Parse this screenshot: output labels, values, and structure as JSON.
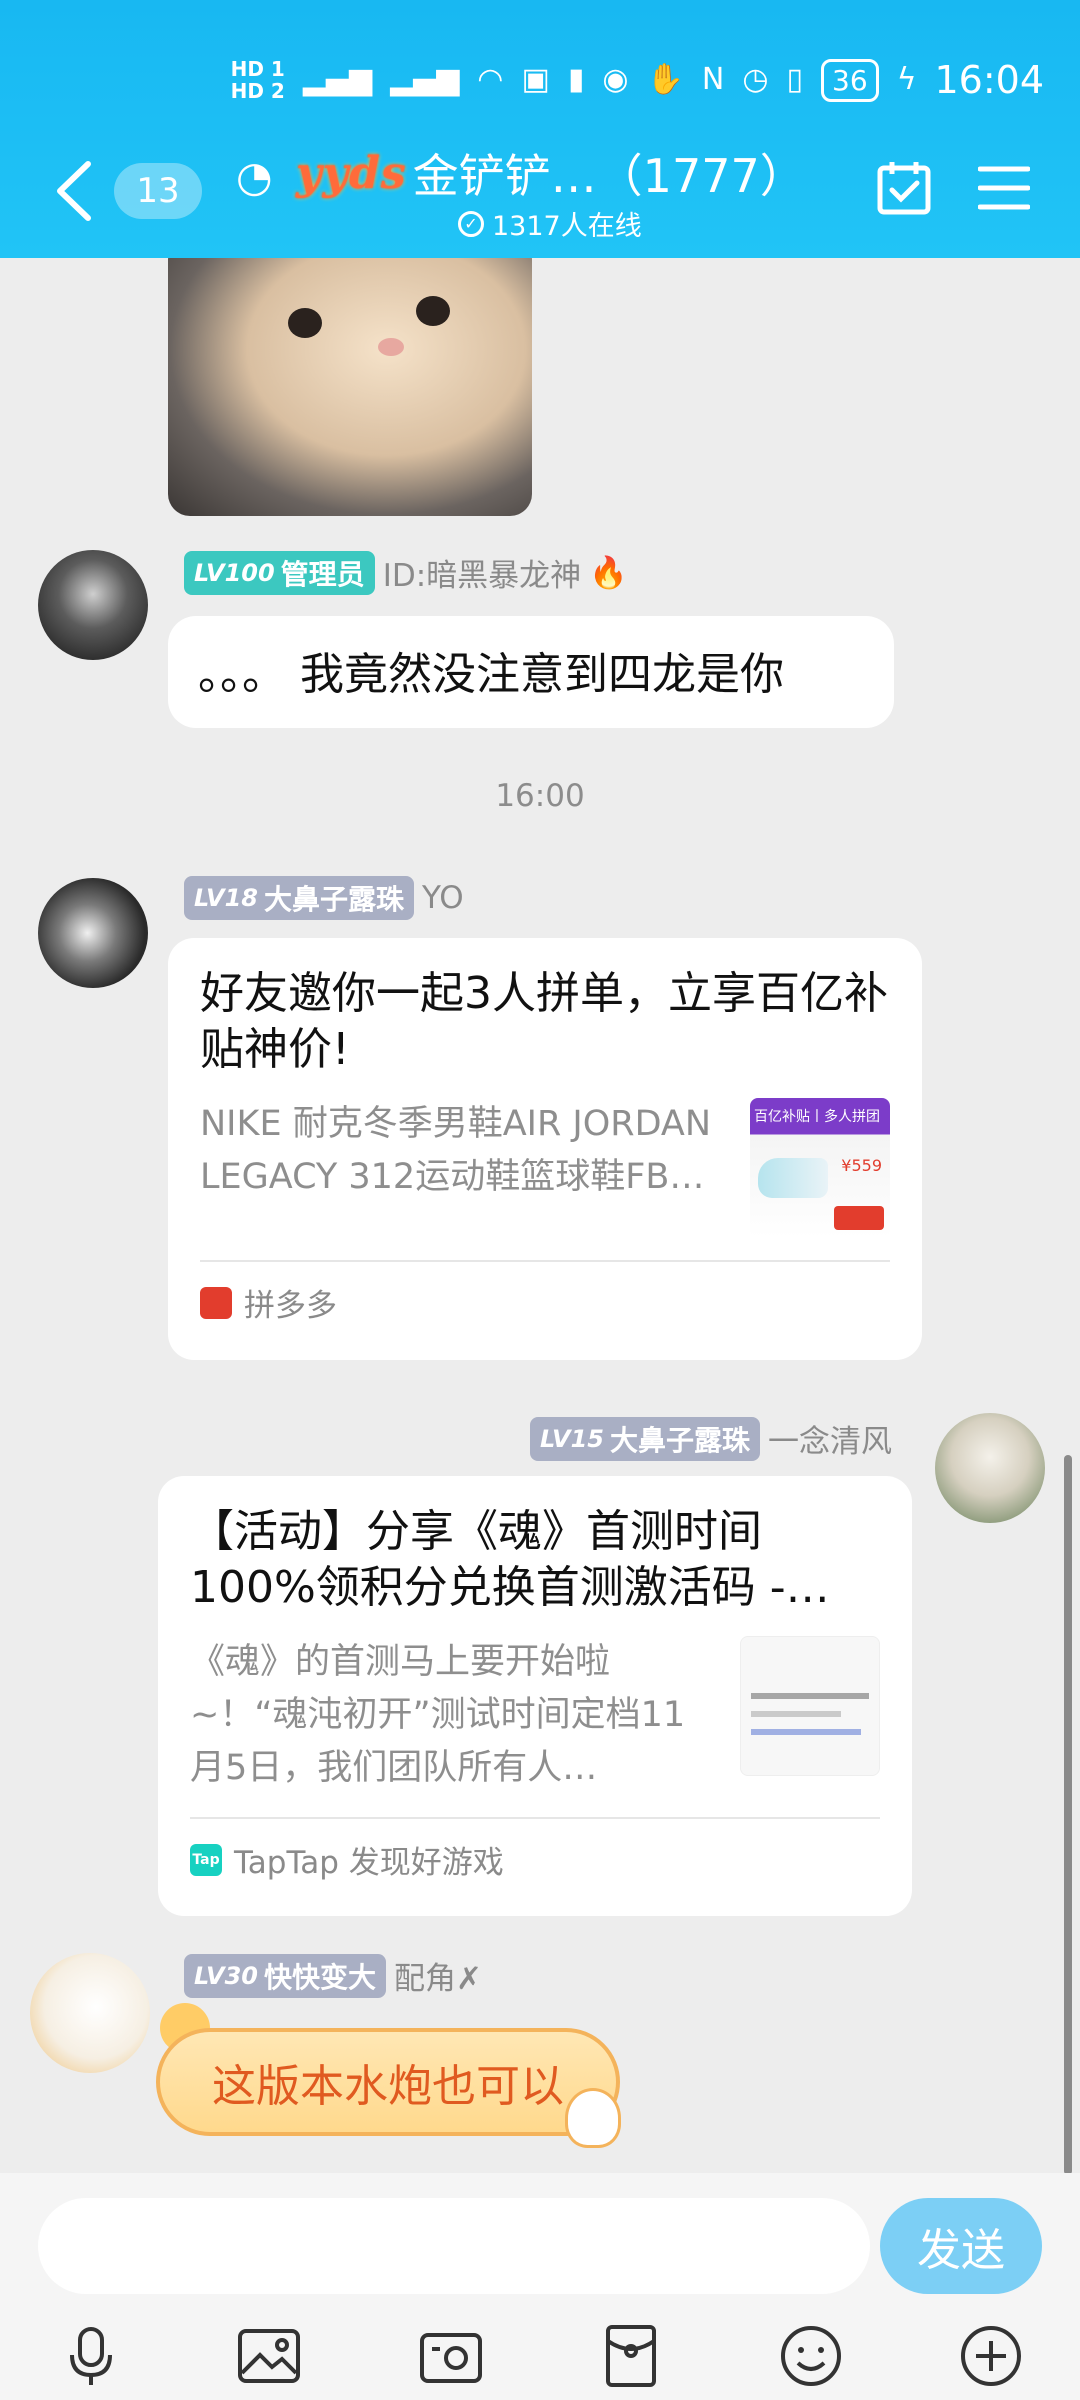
{
  "status_bar": {
    "hd1": "HD 1",
    "hd2": "HD 2",
    "battery": "36",
    "time": "16:04"
  },
  "header": {
    "unread_count": "13",
    "group_logo_text": "yyds",
    "title": "金铲铲…（1777）",
    "online_text": "1317人在线"
  },
  "messages": [
    {
      "type": "image",
      "description_icon": "cat-sticker"
    },
    {
      "type": "text",
      "level": "LV100",
      "role": "管理员",
      "sender": "ID:暗黑暴龙神",
      "emoji": "🔥",
      "text": "。。。 我竟然没注意到四龙是你"
    },
    {
      "type": "timestamp",
      "text": "16:00"
    },
    {
      "type": "card",
      "level": "LV18",
      "tag": "大鼻子露珠",
      "sender": "YO",
      "title": "好友邀你一起3人拼单，立享百亿补贴神价!",
      "description": "NIKE 耐克冬季男鞋AIR JORDAN LEGACY 312运动鞋篮球鞋FB…",
      "thumb_title": "百亿补贴丨多人拼团",
      "thumb_price": "¥559",
      "source": "拼多多"
    },
    {
      "type": "card",
      "level": "LV15",
      "tag": "大鼻子露珠",
      "sender": "一念清风",
      "title": "【活动】分享《魂》首测时间100%领积分兑换首测激活码 -…",
      "description": "《魂》的首测马上要开始啦~！“魂沌初开”测试时间定档11月5日，我们团队所有人…",
      "source": "TapTap 发现好游戏"
    },
    {
      "type": "fancy-text",
      "level": "LV30",
      "tag": "快快变大",
      "sender": "配角✗",
      "text": "这版本水炮也可以"
    }
  ],
  "input": {
    "placeholder": "",
    "send_label": "发送"
  },
  "toolbar": {
    "icons": [
      "microphone-icon",
      "image-icon",
      "camera-icon",
      "redpacket-icon",
      "emoji-icon",
      "plus-icon"
    ]
  },
  "colors": {
    "header": "#21c4f6",
    "send_button": "#7ccff5",
    "lv_admin": "#3cc8c0",
    "lv_member": "#a9afc4"
  }
}
